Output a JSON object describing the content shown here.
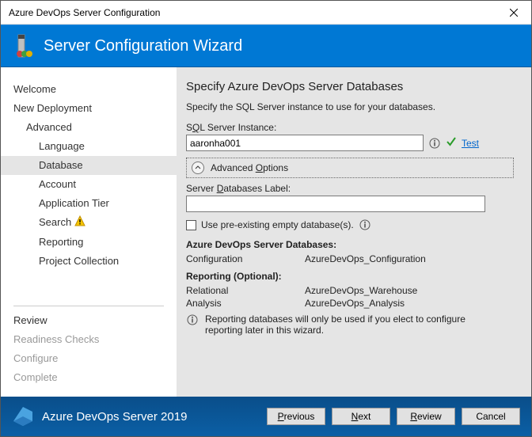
{
  "window": {
    "title": "Azure DevOps Server Configuration"
  },
  "banner": {
    "title": "Server Configuration Wizard"
  },
  "sidebar": {
    "items": [
      {
        "label": "Welcome",
        "level": 1
      },
      {
        "label": "New Deployment",
        "level": 1
      },
      {
        "label": "Advanced",
        "level": 2
      },
      {
        "label": "Language",
        "level": 3
      },
      {
        "label": "Database",
        "level": 3,
        "selected": true
      },
      {
        "label": "Account",
        "level": 3
      },
      {
        "label": "Application Tier",
        "level": 3
      },
      {
        "label": "Search",
        "level": 3,
        "warn": true
      },
      {
        "label": "Reporting",
        "level": 3
      },
      {
        "label": "Project Collection",
        "level": 3
      }
    ],
    "bottom": [
      {
        "label": "Review"
      },
      {
        "label": "Readiness Checks",
        "disabled": true
      },
      {
        "label": "Configure",
        "disabled": true
      },
      {
        "label": "Complete",
        "disabled": true
      }
    ]
  },
  "main": {
    "heading": "Specify Azure DevOps Server Databases",
    "lead": "Specify the SQL Server instance to use for your databases.",
    "sql_label_pre": "S",
    "sql_label_u": "Q",
    "sql_label_post": "L Server Instance:",
    "sql_value": "aaronha001",
    "test": "Test",
    "adv_pre": "Advanced ",
    "adv_u": "O",
    "adv_post": "ptions",
    "db_label_pre": "Server ",
    "db_label_u": "D",
    "db_label_post": "atabases Label:",
    "db_value": "",
    "chk_label": "Use pre-existing empty database(s).",
    "server_db_heading": "Azure DevOps Server Databases:",
    "cfg_k": "Configuration",
    "cfg_v": "AzureDevOps_Configuration",
    "report_heading": "Reporting (Optional):",
    "rel_k": "Relational",
    "rel_v": "AzureDevOps_Warehouse",
    "ana_k": "Analysis",
    "ana_v": "AzureDevOps_Analysis",
    "note": "Reporting databases will only be used if you elect to configure reporting later in this wizard."
  },
  "footer": {
    "product": "Azure DevOps Server 2019",
    "prev_u": "P",
    "prev_post": "revious",
    "next_u": "N",
    "next_post": "ext",
    "review_u": "R",
    "review_post": "eview",
    "cancel": "Cancel"
  }
}
